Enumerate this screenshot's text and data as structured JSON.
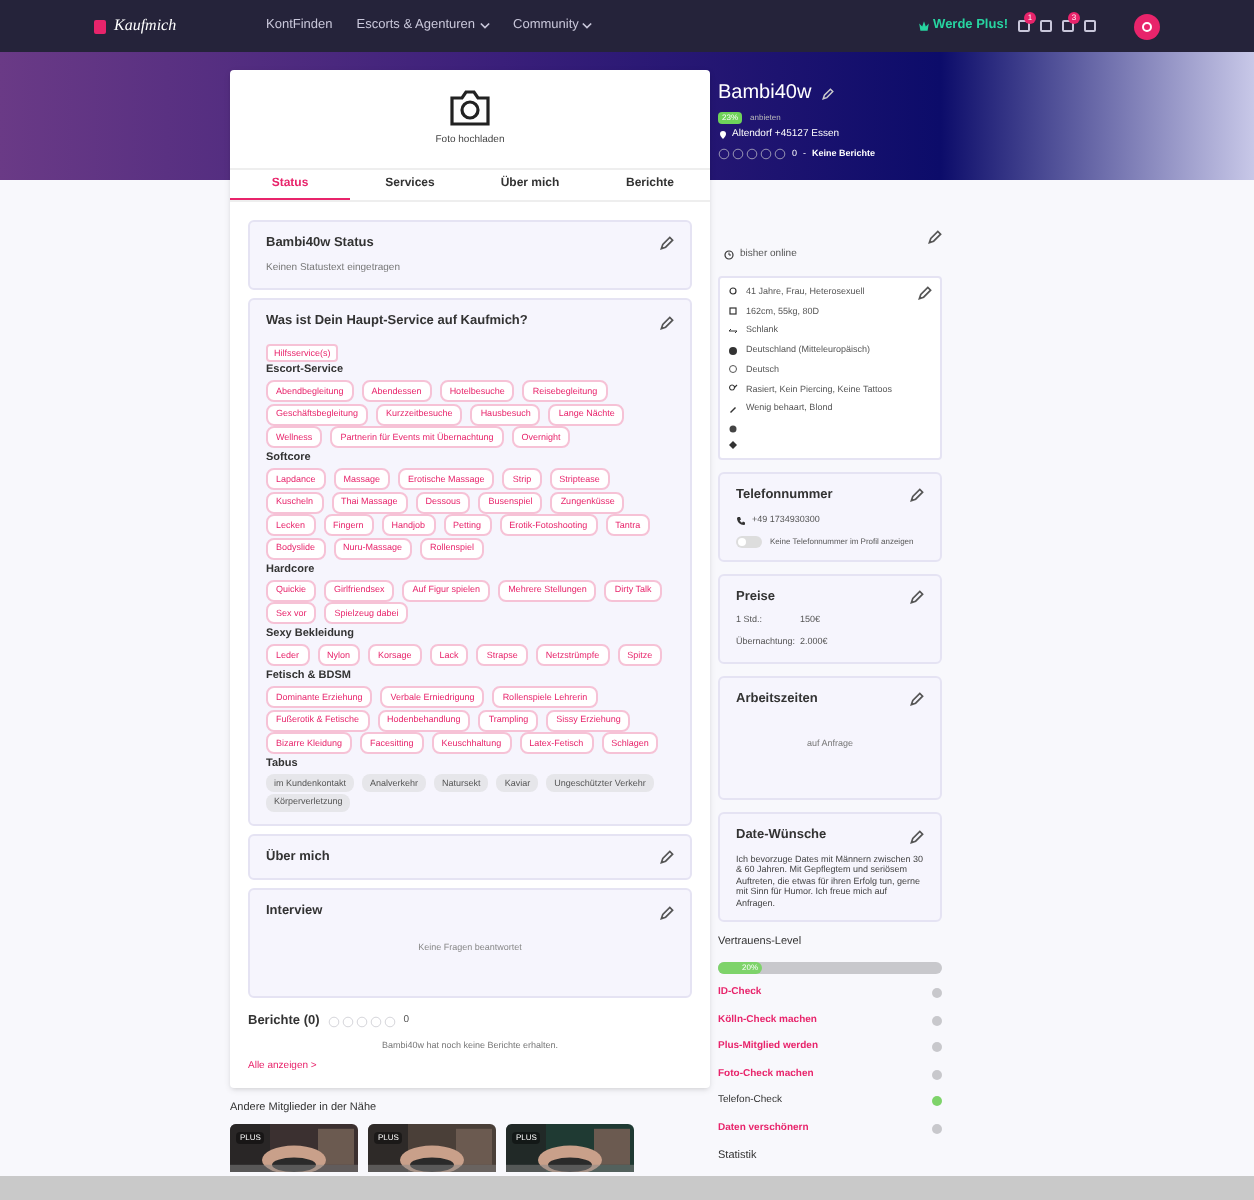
{
  "header": {
    "logo": "Kaufmich",
    "nav": [
      {
        "label": "KontFinden",
        "dropdown": false
      },
      {
        "label": "Escorts & Agenturen",
        "dropdown": true
      },
      {
        "label": "Community",
        "dropdown": true
      }
    ],
    "plus": "Werde Plus!",
    "badges": [
      "1",
      "3"
    ]
  },
  "profile": {
    "name": "Bambi40w",
    "percent": "23%",
    "sub": "anbieten",
    "location": "Altendorf +45127 Essen",
    "rating": "0",
    "separator": "-",
    "reports": "Keine Berichte",
    "stars": 0
  },
  "photo": {
    "label": "Foto hochladen"
  },
  "tabs": [
    {
      "label": "Status",
      "selected": true
    },
    {
      "label": "Services",
      "selected": false
    },
    {
      "label": "Über mich",
      "selected": false
    },
    {
      "label": "Berichte",
      "selected": false
    }
  ],
  "status_card": {
    "title": "Bambi40w Status",
    "text": "Keinen Statustext eingetragen"
  },
  "services": {
    "title": "Was ist Dein Haupt-Service auf Kaufmich?",
    "main": "Hilfsservice(s)",
    "groups": [
      {
        "title": "Escort-Service",
        "kind": "service",
        "tags": [
          "Abendbegleitung",
          "Abendessen",
          "Hotelbesuche",
          "Reisebegleitung",
          "Geschäftsbegleitung",
          "Kurzzeitbesuche",
          "Hausbesuch",
          "Lange Nächte",
          "Wellness",
          "Partnerin für Events mit Übernachtung",
          "Overnight"
        ]
      },
      {
        "title": "Softcore",
        "kind": "service",
        "tags": [
          "Lapdance",
          "Massage",
          "Erotische Massage",
          "Strip",
          "Striptease",
          "Kuscheln",
          "Thai Massage",
          "Dessous",
          "Busenspiel",
          "Zungenküsse",
          "Lecken",
          "Fingern",
          "Handjob",
          "Petting",
          "Erotik-Fotoshooting",
          "Tantra",
          "Bodyslide",
          "Nuru-Massage",
          "Rollenspiel"
        ]
      },
      {
        "title": "Hardcore",
        "kind": "service",
        "tags": [
          "Quickie",
          "Girlfriendsex",
          "Auf Figur spielen",
          "Mehrere Stellungen",
          "Dirty Talk",
          "Sex vor",
          "Spielzeug dabei"
        ]
      },
      {
        "title": "Sexy Bekleidung",
        "kind": "service",
        "tags": [
          "Leder",
          "Nylon",
          "Korsage",
          "Lack",
          "Strapse",
          "Netzstrümpfe",
          "Spitze"
        ]
      },
      {
        "title": "Fetisch & BDSM",
        "kind": "service",
        "tags": [
          "Dominante Erziehung",
          "Verbale Erniedrigung",
          "Rollenspiele Lehrerin",
          "Fußerotik & Fetische",
          "Hodenbehandlung",
          "Trampling",
          "Sissy Erziehung",
          "Bizarre Kleidung",
          "Facesitting",
          "Keuschhaltung",
          "Latex-Fetisch",
          "Schlagen"
        ]
      },
      {
        "title": "Tabus",
        "kind": "tabu",
        "tags": [
          "im Kundenkontakt",
          "Analverkehr",
          "Natursekt",
          "Kaviar",
          "Ungeschützter Verkehr",
          "Körperverletzung"
        ]
      }
    ]
  },
  "about": {
    "title": "Über mich"
  },
  "interview": {
    "title": "Interview",
    "empty": "Keine Fragen beantwortet"
  },
  "reports": {
    "title": "Berichte (0)",
    "stars": 0,
    "count": "0",
    "empty": "Bambi40w hat noch keine Berichte erhalten.",
    "link": "Alle anzeigen >"
  },
  "nearby": {
    "title": "Andere Mitglieder in der Nähe",
    "members": [
      {
        "badge": "PLUS"
      },
      {
        "badge": "PLUS"
      },
      {
        "badge": "PLUS"
      }
    ]
  },
  "sidebar": {
    "online": "bisher online",
    "details": [
      {
        "kind": "text",
        "text": "41 Jahre, Frau, Heterosexuell"
      },
      {
        "kind": "text",
        "text": "162cm, 55kg, 80D"
      },
      {
        "kind": "text",
        "text": "Schlank"
      },
      {
        "kind": "text",
        "text": "Deutschland (Mitteleuropäisch)"
      },
      {
        "kind": "text",
        "text": "Deutsch"
      },
      {
        "kind": "text",
        "text": "Rasiert, Kein Piercing, Keine Tattoos"
      },
      {
        "kind": "text",
        "text": "Wenig behaart, Blond"
      },
      {
        "kind": "empty"
      },
      {
        "kind": "empty"
      }
    ],
    "phone": {
      "title": "Telefonnummer",
      "number": "+49 1734930300",
      "shown": false,
      "toggle_label": "Keine Telefonnummer im Profil anzeigen"
    },
    "prices": {
      "title": "Preise",
      "rows": [
        {
          "label": "1 Std.:",
          "value": "150€"
        },
        {
          "label": "Übernachtung:",
          "value": "2.000€"
        }
      ]
    },
    "hours": {
      "title": "Arbeitszeiten",
      "text": "auf Anfrage"
    },
    "wishes": {
      "title": "Date-Wünsche",
      "text": "Ich bevorzuge Dates mit Männern zwischen 30 & 60 Jahren. Mit Gepflegtem und seriösem Auftreten, die etwas für ihren Erfolg tun, gerne mit Sinn für Humor. Ich freue mich auf Anfragen."
    },
    "trust": {
      "title": "Vertrauens-Level",
      "level": 0.2,
      "reading": "20%",
      "items": [
        {
          "label": "ID-Check",
          "done": false
        },
        {
          "label": "Kölln-Check machen",
          "done": false
        },
        {
          "label": "Plus-Mitglied werden",
          "done": false
        },
        {
          "label": "Foto-Check machen",
          "done": false
        },
        {
          "label": "Telefon-Check",
          "done": true
        },
        {
          "label": "Daten verschönern",
          "done": false
        }
      ]
    },
    "stats": {
      "title": "Statistik"
    }
  }
}
